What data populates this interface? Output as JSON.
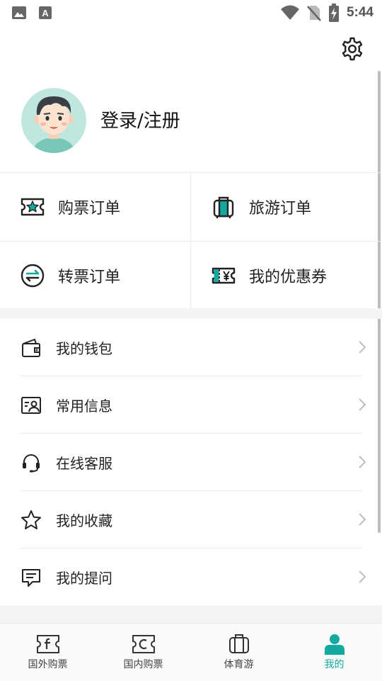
{
  "status_bar": {
    "time": "5:44",
    "icons": [
      "image-icon",
      "font-app-icon",
      "wifi-icon",
      "no-sim-icon",
      "battery-charging-icon"
    ]
  },
  "settings": {
    "icon": "gear-icon"
  },
  "profile": {
    "login_label": "登录/注册"
  },
  "order_grid": {
    "items": [
      {
        "label": "购票订单",
        "icon": "ticket-star-icon"
      },
      {
        "label": "旅游订单",
        "icon": "luggage-icon"
      },
      {
        "label": "转票订单",
        "icon": "transfer-icon"
      },
      {
        "label": "我的优惠券",
        "icon": "coupon-yen-icon"
      }
    ]
  },
  "menu": {
    "items": [
      {
        "label": "我的钱包",
        "icon": "wallet-icon"
      },
      {
        "label": "常用信息",
        "icon": "id-card-icon"
      },
      {
        "label": "在线客服",
        "icon": "headset-icon"
      },
      {
        "label": "我的收藏",
        "icon": "star-icon"
      },
      {
        "label": "我的提问",
        "icon": "message-icon"
      }
    ]
  },
  "tabbar": {
    "active_index": 3,
    "accent_color": "#12a9a0",
    "tabs": [
      {
        "label": "国外购票",
        "icon": "ticket-f-icon"
      },
      {
        "label": "国内购票",
        "icon": "ticket-c-icon"
      },
      {
        "label": "体育游",
        "icon": "luggage-icon"
      },
      {
        "label": "我的",
        "icon": "user-icon"
      }
    ]
  }
}
